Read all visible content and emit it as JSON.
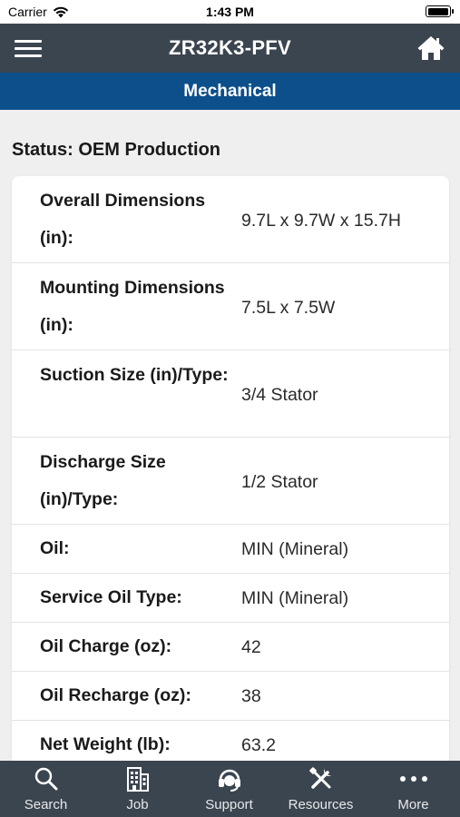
{
  "status_bar": {
    "carrier": "Carrier",
    "time": "1:43 PM",
    "battery_level": 1.0
  },
  "header": {
    "title": "ZR32K3-PFV",
    "menu_icon": "hamburger-menu-icon",
    "home_icon": "home-icon"
  },
  "section": {
    "title": "Mechanical"
  },
  "status_text": "Status: OEM Production",
  "specs": [
    {
      "label": "Overall Dimensions (in):",
      "value": "9.7L x 9.7W x 15.7H"
    },
    {
      "label": "Mounting Dimensions (in):",
      "value": "7.5L x 7.5W"
    },
    {
      "label": "Suction Size (in)/Type:",
      "value": "3/4 Stator"
    },
    {
      "label": "Discharge Size (in)/Type:",
      "value": "1/2 Stator"
    },
    {
      "label": "Oil:",
      "value": "MIN (Mineral)"
    },
    {
      "label": "Service Oil Type:",
      "value": "MIN (Mineral)"
    },
    {
      "label": "Oil Charge (oz):",
      "value": "42"
    },
    {
      "label": "Oil Recharge (oz):",
      "value": "38"
    },
    {
      "label": "Net Weight (lb):",
      "value": "63.2"
    }
  ],
  "tabs": [
    {
      "label": "Search",
      "icon": "search-icon"
    },
    {
      "label": "Job",
      "icon": "building-icon"
    },
    {
      "label": "Support",
      "icon": "headset-icon"
    },
    {
      "label": "Resources",
      "icon": "tools-icon"
    },
    {
      "label": "More",
      "icon": "more-dots-icon"
    }
  ],
  "colors": {
    "nav_bar": "#3b4550",
    "section_header": "#0d4f8b",
    "background": "#efefef"
  }
}
